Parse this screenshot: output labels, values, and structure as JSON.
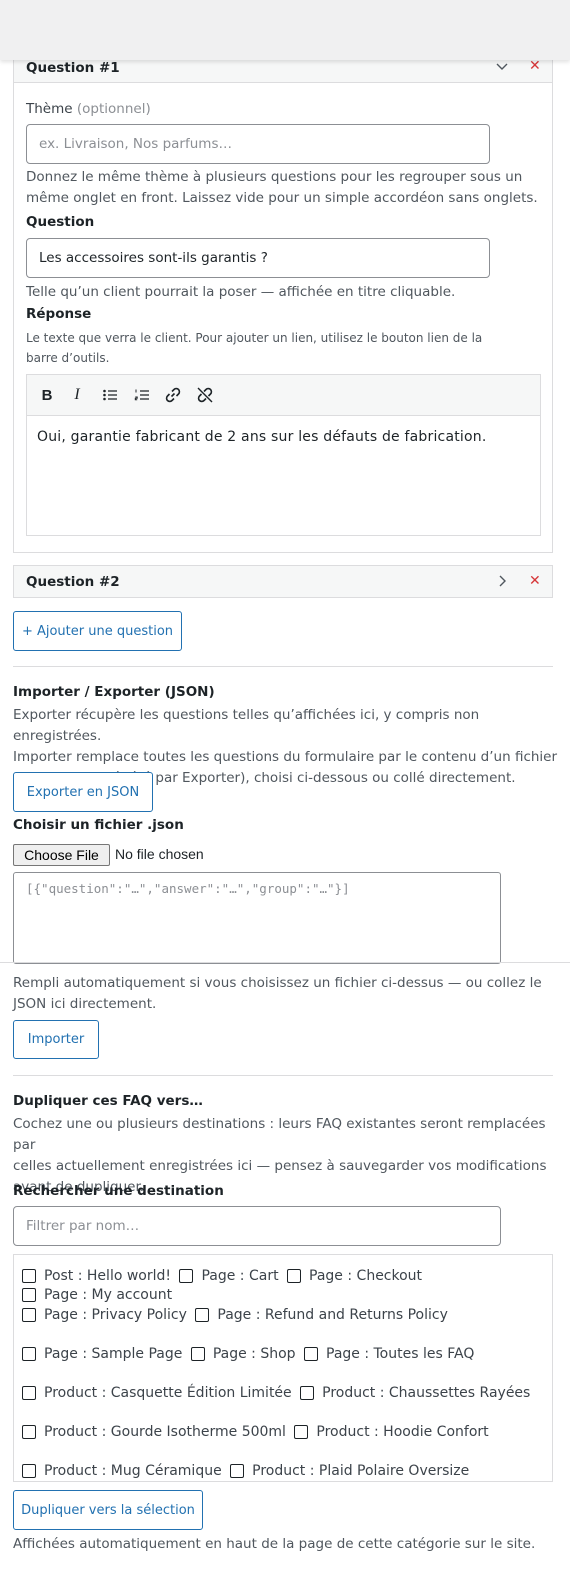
{
  "question1": {
    "title": "Question #1",
    "theme_label": "Thème",
    "theme_optional": "(optionnel)",
    "theme_placeholder": "ex. Livraison, Nos parfums…",
    "theme_help_1": "Donnez le même thème à plusieurs questions pour les regrouper sous un",
    "theme_help_2": "même onglet en front. Laissez vide pour un simple accordéon sans onglets.",
    "question_label": "Question",
    "question_value": "Les accessoires sont-ils garantis ?",
    "question_help": "Telle qu’un client pourrait la poser — affichée en titre cliquable.",
    "answer_label": "Réponse",
    "answer_help_1": "Le texte que verra le client. Pour ajouter un lien, utilisez le bouton lien de la",
    "answer_help_2": "barre d’outils.",
    "answer_value": "Oui, garantie fabricant de 2 ans sur les défauts de fabrication."
  },
  "question2": {
    "title": "Question #2"
  },
  "add_question_label": "+ Ajouter une question",
  "import_export": {
    "heading": "Importer / Exporter (JSON)",
    "desc_1": "Exporter récupère les questions telles qu’affichées ici, y compris non enregistrées.",
    "desc_2": "Importer remplace toutes les questions du formulaire par le contenu d’un fichier",
    "desc_3": ".json (format généré par Exporter), choisi ci-dessous ou collé directement.",
    "export_label": "Exporter en JSON",
    "file_label": "Choisir un fichier .json",
    "choose_file": "Choose File",
    "no_file": "No file chosen",
    "json_placeholder": "[{\"question\":\"…\",\"answer\":\"…\",\"group\":\"…\"}]",
    "fill_help_1": "Rempli automatiquement si vous choisissez un fichier ci-dessus — ou collez le",
    "fill_help_2": "JSON ici directement.",
    "import_label": "Importer"
  },
  "duplicate": {
    "heading": "Dupliquer ces FAQ vers…",
    "desc_1": "Cochez une ou plusieurs destinations : leurs FAQ existantes seront remplacées par",
    "desc_2": "celles actuellement enregistrées ici — pensez à sauvegarder vos modifications",
    "desc_3": "avant de dupliquer.",
    "search_label": "Rechercher une destination",
    "search_placeholder": "Filtrer par nom…",
    "destinations": [
      [
        "Post : Hello world!",
        "Page : Cart",
        "Page : Checkout",
        "Page : My account"
      ],
      [
        "Page : Privacy Policy",
        "Page : Refund and Returns Policy"
      ],
      [
        "Page : Sample Page",
        "Page : Shop",
        "Page : Toutes les FAQ"
      ],
      [
        "Product : Casquette Édition Limitée",
        "Product : Chaussettes Rayées"
      ],
      [
        "Product : Gourde Isotherme 500ml",
        "Product : Hoodie Confort"
      ],
      [
        "Product : Mug Céramique",
        "Product : Plaid Polaire Oversize"
      ]
    ],
    "submit_label": "Dupliquer vers la sélection"
  },
  "footer_note": "Affichées automatiquement en haut de la page de cette catégorie sur le site.",
  "icons": {
    "toolbar": [
      "bold-icon",
      "italic-icon",
      "bullet-list-icon",
      "numbered-list-icon",
      "link-icon",
      "unlink-icon"
    ],
    "remove": "close-icon",
    "collapse": "chevron-down-icon",
    "expand": "chevron-right-icon"
  },
  "colors": {
    "accent": "#2271b1",
    "danger": "#d63638",
    "border": "#dcdcde"
  }
}
